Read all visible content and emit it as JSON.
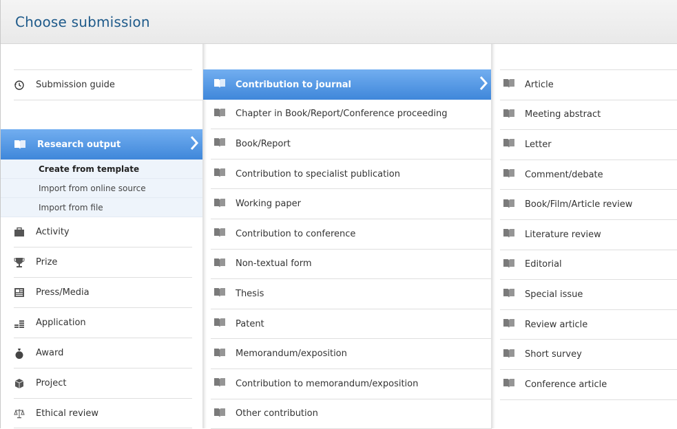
{
  "header": {
    "title": "Choose submission"
  },
  "col1": {
    "guide_label": "Submission guide",
    "research_label": "Research output",
    "sub_items": [
      "Create from template",
      "Import from online source",
      "Import from file"
    ],
    "items": [
      "Activity",
      "Prize",
      "Press/Media",
      "Application",
      "Award",
      "Project",
      "Ethical review"
    ]
  },
  "col2": {
    "items": [
      "Contribution to journal",
      "Chapter in Book/Report/Conference proceeding",
      "Book/Report",
      "Contribution to specialist publication",
      "Working paper",
      "Contribution to conference",
      "Non-textual form",
      "Thesis",
      "Patent",
      "Memorandum/exposition",
      "Contribution to memorandum/exposition",
      "Other contribution"
    ]
  },
  "col3": {
    "items": [
      "Article",
      "Meeting abstract",
      "Letter",
      "Comment/debate",
      "Book/Film/Article review",
      "Literature review",
      "Editorial",
      "Special issue",
      "Review article",
      "Short survey",
      "Conference article"
    ]
  },
  "colors": {
    "accent": "#4a90e2",
    "title": "#1e5a8a",
    "icon": "#7a7a7a"
  }
}
